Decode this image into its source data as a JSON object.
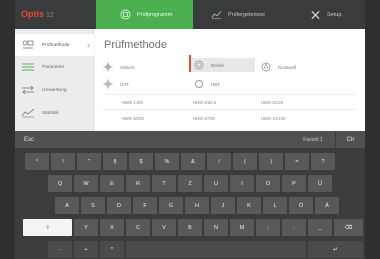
{
  "topbar": {
    "logo": "Optis",
    "logo_sub": "12",
    "nav": [
      {
        "label": "Prüfprogramm",
        "icon": "grid-icon"
      },
      {
        "label": "Prüfergebnisse",
        "icon": "chart-line-icon"
      },
      {
        "label": "Setup",
        "icon": "tools-icon"
      }
    ],
    "colors": {
      "accent": "#4caf50",
      "brand": "#e14b3b",
      "bar": "#3a3b3d"
    }
  },
  "sidebar": {
    "items": [
      {
        "label": "Prüfmethode",
        "icon": "hardness-tester-icon"
      },
      {
        "label": "Parameter",
        "icon": "sliders-icon"
      },
      {
        "label": "Umwertung",
        "icon": "conversion-icon"
      },
      {
        "label": "Statistik",
        "icon": "statistics-icon"
      }
    ]
  },
  "main": {
    "title": "Prüfmethode",
    "methods": [
      {
        "label": "Vickers",
        "icon": "vickers-icon"
      },
      {
        "label": "Brinell",
        "icon": "brinell-icon"
      },
      {
        "label": "Rockwell",
        "icon": "rockwell-icon"
      },
      {
        "label": "UVT",
        "icon": "uvt-icon"
      },
      {
        "label": "HBT",
        "icon": "hbt-icon"
      }
    ],
    "row1": [
      "HBW 2,5/5",
      "HBW 5/62,5",
      "HBW 5/125"
    ],
    "row2": [
      "HBW 5/250",
      "HBW 5/750",
      "HBW 10/100"
    ]
  },
  "keyboard": {
    "esc": "Esc",
    "favorit": "Favorit 1",
    "clr": "Clr",
    "row_symbols": [
      "°",
      "!",
      "\"",
      "§",
      "$",
      "%",
      "&",
      "/",
      "(",
      ")",
      "=",
      "?"
    ],
    "row1": [
      "Q",
      "W",
      "E",
      "R",
      "T",
      "Z",
      "U",
      "I",
      "O",
      "P",
      "Ü"
    ],
    "row2": [
      "A",
      "S",
      "D",
      "F",
      "G",
      "H",
      "J",
      "K",
      "L",
      "Ö",
      "Ä"
    ],
    "row3": [
      "Y",
      "X",
      "C",
      "V",
      "B",
      "N",
      "M",
      ";",
      ":",
      "_"
    ],
    "row4": [
      "-",
      "+",
      "*"
    ],
    "backspace": "⌫",
    "enter": "↵",
    "shift": "⇧"
  }
}
